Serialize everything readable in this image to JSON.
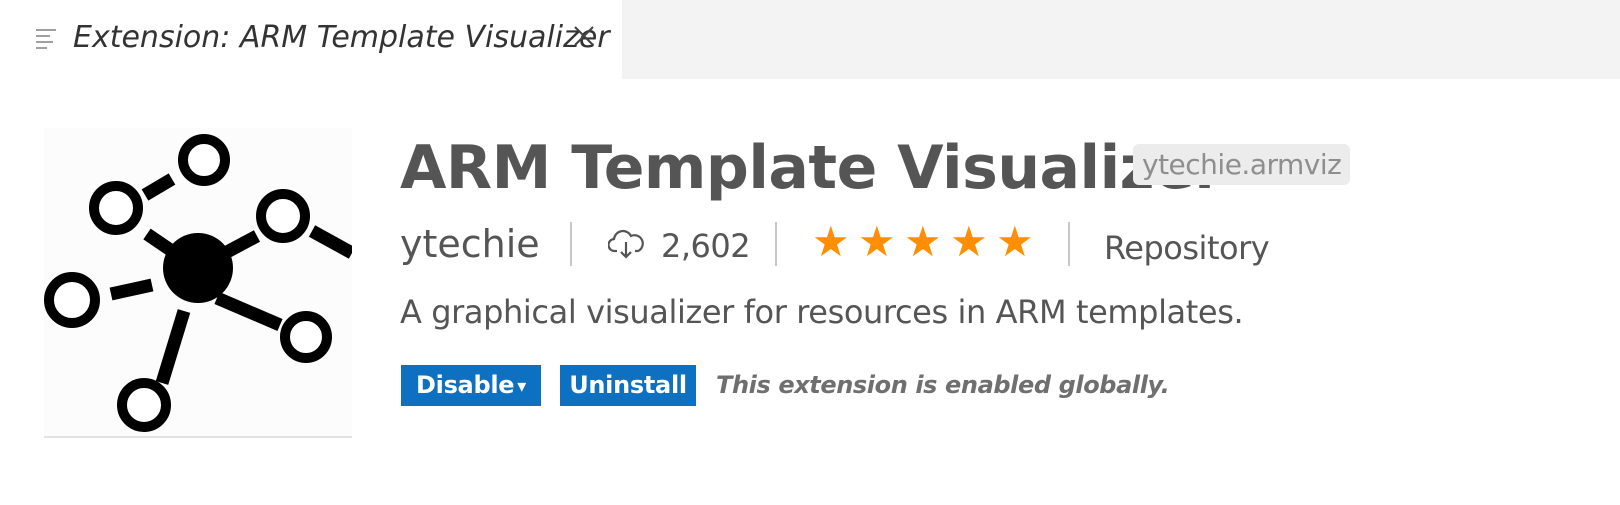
{
  "tab": {
    "title": "Extension: ARM Template Visualizer",
    "icon": "preview-lines-icon",
    "close_icon": "close-icon"
  },
  "extension": {
    "logo_icon": "network-graph-icon",
    "name": "ARM Template Visualizer",
    "identifier": "ytechie.armviz",
    "publisher": "ytechie",
    "install_count": "2,602",
    "install_icon": "cloud-download-icon",
    "rating": 5,
    "rating_max": 5,
    "star_glyph": "★",
    "repository_label": "Repository",
    "description": "A graphical visualizer for resources in ARM templates."
  },
  "actions": {
    "disable_label": "Disable",
    "disable_caret": "▾",
    "uninstall_label": "Uninstall",
    "status": "This extension is enabled globally."
  },
  "colors": {
    "button_bg": "#0e70c0",
    "star": "#ff8e00",
    "text": "#555555",
    "tabbar_bg": "#f3f3f3"
  }
}
